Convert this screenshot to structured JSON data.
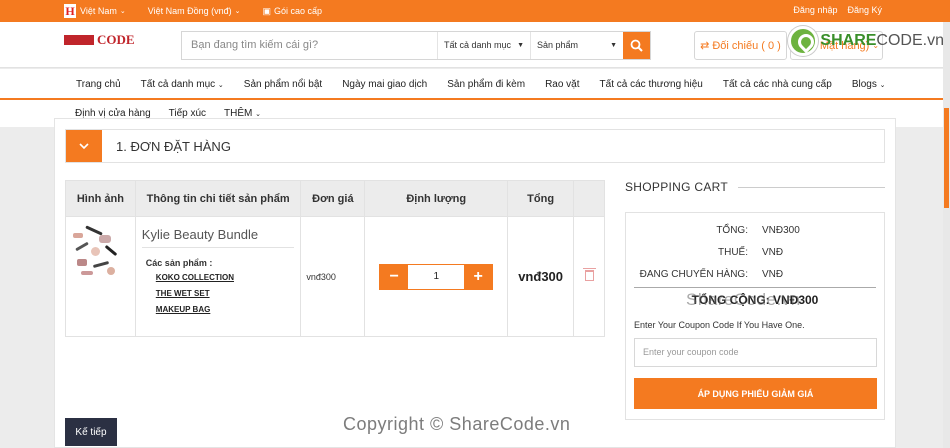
{
  "topbar": {
    "country": "Việt Nam",
    "currency": "Việt Nam Đồng (vnđ)",
    "premium": "Gói cao cấp",
    "login": "Đăng nhập",
    "register": "Đăng Ký"
  },
  "header": {
    "logo_text": "CODE",
    "search_placeholder": "Bạn đang tìm kiếm cái gì?",
    "category_select": "Tất cả danh mục",
    "type_select": "Sản phẩm",
    "compare_label": "Đối chiếu ( 0 )",
    "cart_label": "1 Mặt hàng)",
    "brand_name": "SHARE",
    "brand_suffix": "CODE.vn"
  },
  "nav": {
    "row1": [
      "Trang chủ",
      "Tất cả danh mục",
      "Sản phẩm nổi bật",
      "Ngày mai giao dịch",
      "Sản phẩm đi kèm",
      "Rao vặt",
      "Tất cả các thương hiệu",
      "Tất cả các nhà cung cấp",
      "Blogs"
    ],
    "row2": [
      "Định vị cửa hàng",
      "Tiếp xúc",
      "THÊM"
    ]
  },
  "step": {
    "title": "1. ĐƠN ĐẶT HÀNG"
  },
  "table": {
    "headers": [
      "Hình ảnh",
      "Thông tin chi tiết sản phẩm",
      "Đơn giá",
      "Định lượng",
      "Tổng"
    ],
    "product_name": "Kylie Beauty Bundle",
    "sub_label": "Các sản phẩm :",
    "sub_items": [
      "KOKO COLLECTION",
      "THE WET SET",
      "MAKEUP BAG"
    ],
    "unit_price": "vnđ300",
    "quantity": "1",
    "total": "vnđ300"
  },
  "next_button": "Kế tiếp",
  "summary": {
    "title": "SHOPPING CART",
    "rows": [
      {
        "label": "TỔNG:",
        "value": "VNĐ300"
      },
      {
        "label": "THUẾ:",
        "value": "VNĐ"
      },
      {
        "label": "ĐANG CHUYỂN HÀNG:",
        "value": "VNĐ"
      }
    ],
    "grand_total": "TỔNG CỘNG: VNĐ300",
    "coupon_label": "Enter Your Coupon Code If You Have One.",
    "coupon_placeholder": "Enter your coupon code",
    "coupon_button": "ÁP DỤNG PHIẾU GIẢM GIÁ"
  },
  "watermarks": {
    "center": "ShareCode.vn",
    "bottom": "Copyright © ShareCode.vn"
  },
  "colors": {
    "accent": "#f47a20",
    "dark_button": "#2b3043"
  }
}
